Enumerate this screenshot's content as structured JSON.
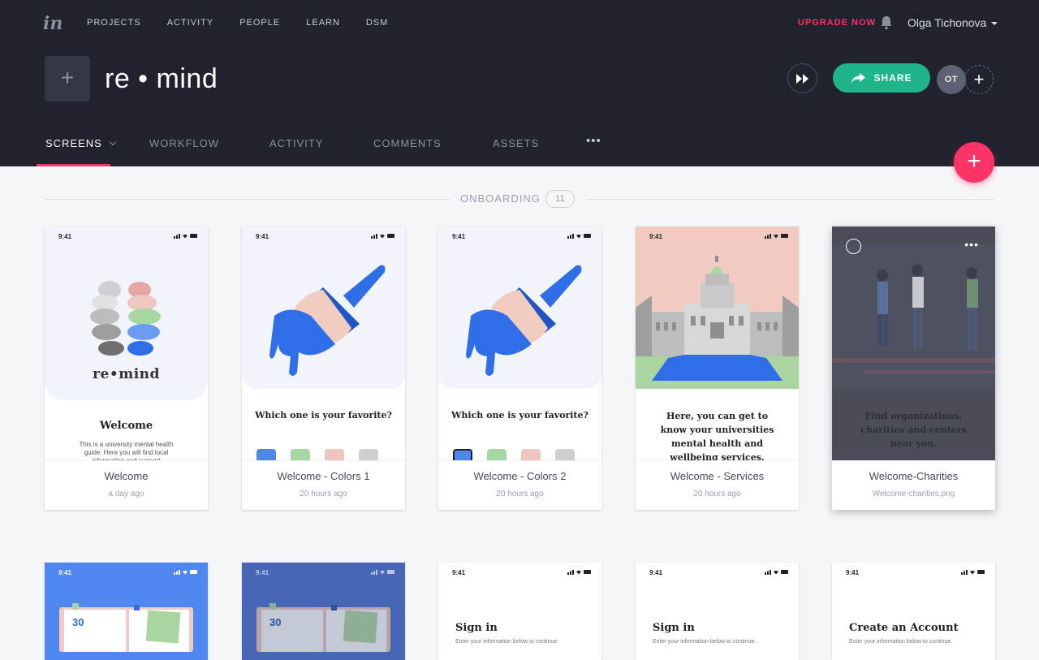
{
  "nav": {
    "logo": "in",
    "items": [
      "PROJECTS",
      "ACTIVITY",
      "PEOPLE",
      "LEARN",
      "DSM"
    ],
    "upgrade": "UPGRADE NOW",
    "user_name": "Olga Tichonova"
  },
  "project": {
    "title": "re • mind",
    "share_label": "SHARE",
    "avatar_initials": "OT"
  },
  "tabs": [
    "SCREENS",
    "WORKFLOW",
    "ACTIVITY",
    "COMMENTS",
    "ASSETS",
    "•••"
  ],
  "section": {
    "label": "ONBOARDING",
    "count": "11"
  },
  "status_time": "9:41",
  "cards_row1": [
    {
      "name": "Welcome",
      "date": "a day ago",
      "heading": "Welcome",
      "body": "This is a university mental health guide. Here you will find local information and support",
      "logo_text": "re•mind"
    },
    {
      "name": "Welcome - Colors 1",
      "date": "20 hours ago",
      "heading": "Which one is your favorite?"
    },
    {
      "name": "Welcome - Colors 2",
      "date": "20 hours ago",
      "heading": "Which one is your favorite?"
    },
    {
      "name": "Welcome - Services",
      "date": "20 hours ago",
      "heading": "Here, you can get to know your universities mental health and wellbeing services."
    },
    {
      "name": "Welcome-Charities",
      "date": "Welcome-charities.png",
      "heading": "Find organizations, charities and centers near you."
    }
  ],
  "cards_row2": [
    {
      "calendar_day": "30"
    },
    {
      "calendar_day": "30"
    },
    {
      "heading": "Sign in",
      "sub": "Enter your information below to continue."
    },
    {
      "heading": "Sign in",
      "sub": "Enter your information below to continue."
    },
    {
      "heading": "Create an Account",
      "sub": "Enter your information below to continue."
    }
  ],
  "colors": {
    "accent": "#ff3366",
    "share": "#1fb589",
    "topbar": "#20232e",
    "brush_blue": "#2f6ee6"
  }
}
